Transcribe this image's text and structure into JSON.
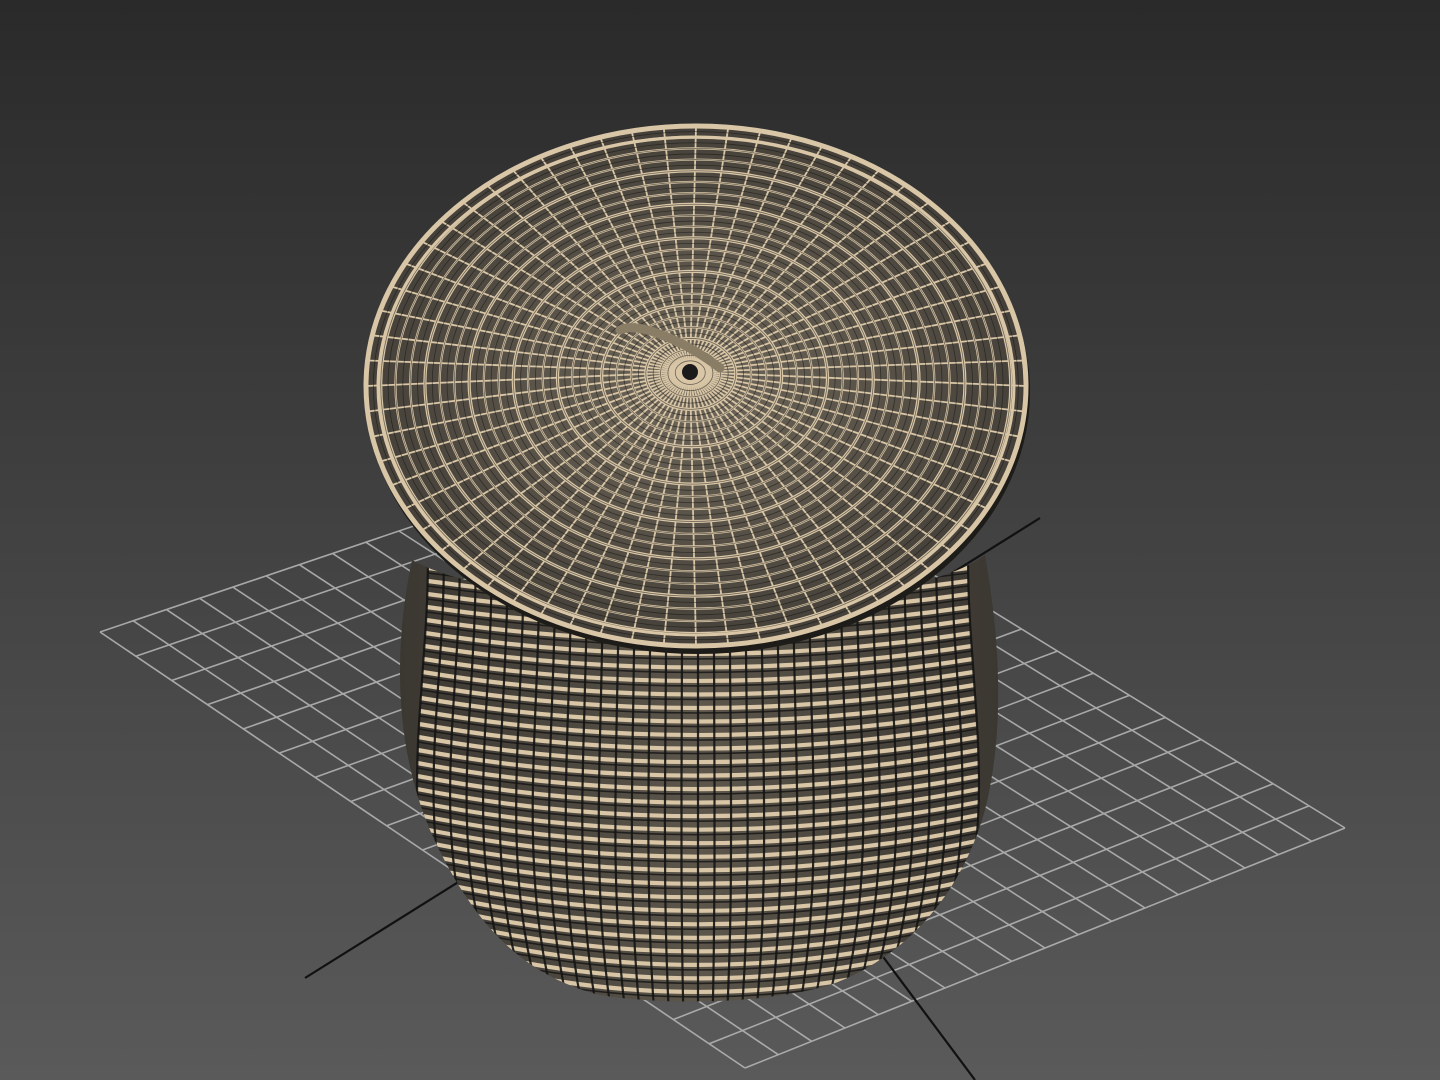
{
  "viewport": {
    "mode": "wireframe-perspective",
    "background_top": "#2a2a2a",
    "background_bottom": "#5a5a5a",
    "grid_color": "#b9b9b9",
    "axis_color": "#111111"
  },
  "scene_object": {
    "type": "wicker-basket-with-lid",
    "wire_color": "#d8c6a6",
    "wire_shadow": "#141414",
    "lid_handle_color": "#8a7d66",
    "center_hole_color": "#1a1a1a"
  }
}
